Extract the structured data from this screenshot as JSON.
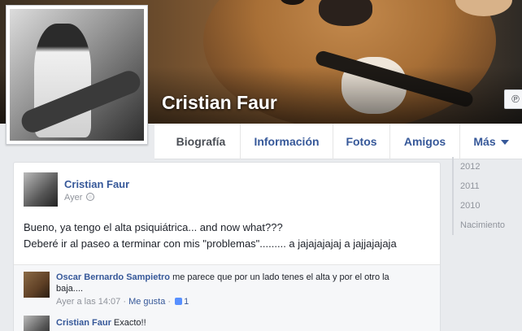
{
  "profile": {
    "name": "Cristian Faur"
  },
  "nav": {
    "tabs": [
      {
        "label": "Biografía",
        "active": true
      },
      {
        "label": "Información"
      },
      {
        "label": "Fotos"
      },
      {
        "label": "Amigos"
      },
      {
        "label": "Más"
      }
    ]
  },
  "post": {
    "author": "Cristian Faur",
    "time": "Ayer",
    "lines": [
      "Bueno, ya tengo el alta psiquiátrica... and now what???",
      "Deberé ir al paseo a terminar con mis \"problemas\"......... a jajajajajaj a jajjajajaja"
    ]
  },
  "comments": [
    {
      "author": "Oscar Bernardo Sampietro",
      "text": "me parece que por un lado tenes el alta y por el otro la baja....",
      "time": "Ayer a las 14:07",
      "like_label": "Me gusta",
      "likes": "1"
    },
    {
      "author": "Cristian Faur",
      "text": "Exacto!!"
    }
  ],
  "timeline_years": [
    "2012",
    "2011",
    "2010",
    "Nacimiento"
  ],
  "icons": {
    "rss": "rss-icon",
    "globe": "globe-icon",
    "like": "thumbs-up-icon",
    "caret": "caret-down-icon"
  }
}
